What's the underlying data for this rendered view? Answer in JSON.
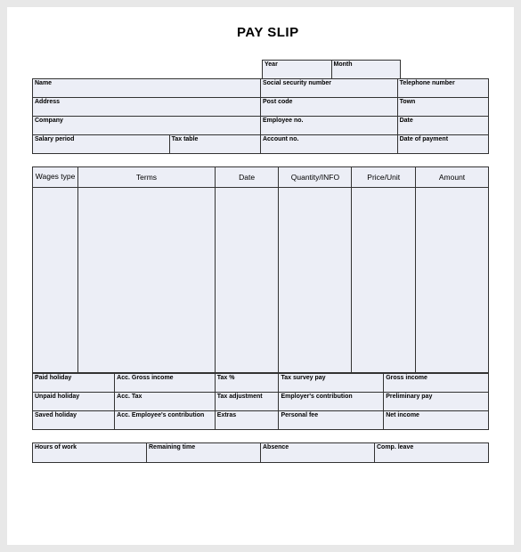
{
  "title": "PAY SLIP",
  "top": {
    "year": "Year",
    "month": "Month"
  },
  "info": {
    "name": "Name",
    "ssn": "Social security number",
    "telephone": "Telephone number",
    "address": "Address",
    "postcode": "Post code",
    "town": "Town",
    "company": "Company",
    "employee_no": "Employee no.",
    "date": "Date",
    "salary_period": "Salary period",
    "tax_table": "Tax table",
    "account_no": "Account no.",
    "date_of_payment": "Date of payment"
  },
  "wages_headers": {
    "wages_type": "Wages type",
    "terms": "Terms",
    "date": "Date",
    "quantity_info": "Quantity/INFO",
    "price_unit": "Price/Unit",
    "amount": "Amount"
  },
  "summary": {
    "r1": {
      "c1": "Paid holiday",
      "c2": "Acc. Gross income",
      "c3": "Tax %",
      "c4": "Tax survey pay",
      "c5": "Gross income"
    },
    "r2": {
      "c1": "Unpaid holiday",
      "c2": "Acc. Tax",
      "c3": "Tax adjustment",
      "c4": "Employer's contribution",
      "c5": "Preliminary pay"
    },
    "r3": {
      "c1": "Saved holiday",
      "c2": "Acc. Employee's contribution",
      "c3": "Extras",
      "c4": "Personal fee",
      "c5": "Net income"
    }
  },
  "footer": {
    "hours": "Hours of work",
    "remaining": "Remaining time",
    "absence": "Absence",
    "comp": "Comp. leave"
  }
}
